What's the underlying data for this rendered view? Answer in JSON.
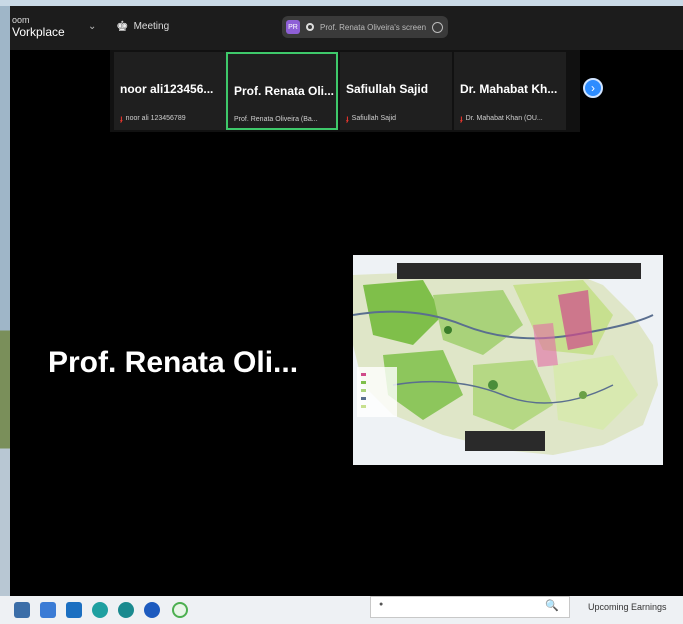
{
  "app": {
    "brand_small": "oom",
    "brand_large": "Vorkplace",
    "meeting_label": "Meeting",
    "share_badge": {
      "avatar_initials": "PR",
      "text": "Prof. Renata Oliveira's screen"
    }
  },
  "participants": [
    {
      "name": "noor ali123456...",
      "subtitle": "noor ali 123456789",
      "active": false,
      "muted": true
    },
    {
      "name": "Prof. Renata Oli...",
      "subtitle": "Prof. Renata Oliveira (Ba...",
      "active": true,
      "muted": false
    },
    {
      "name": "Safiullah Sajid",
      "subtitle": "Safiullah Sajid",
      "active": false,
      "muted": true
    },
    {
      "name": "Dr. Mahabat Kh...",
      "subtitle": "Dr. Mahabat Khan (OU...",
      "active": false,
      "muted": true
    }
  ],
  "next_page_icon": "chevron-right-icon",
  "main": {
    "speaker_name": "Prof. Renata Oli..."
  },
  "shared_content": {
    "description_icon": "map-image"
  },
  "taskbar": {
    "icons": [
      "start-icon",
      "file-explorer-icon",
      "mail-icon",
      "edge-icon",
      "edge-dev-icon",
      "chrome-icon",
      "whatsapp-icon"
    ],
    "search_glyph": "🔍",
    "weather_text": "Upcoming Earnings"
  },
  "colors": {
    "active_border": "#3ec86a",
    "accent": "#2d8cff",
    "muted_mic": "#e0342c"
  }
}
